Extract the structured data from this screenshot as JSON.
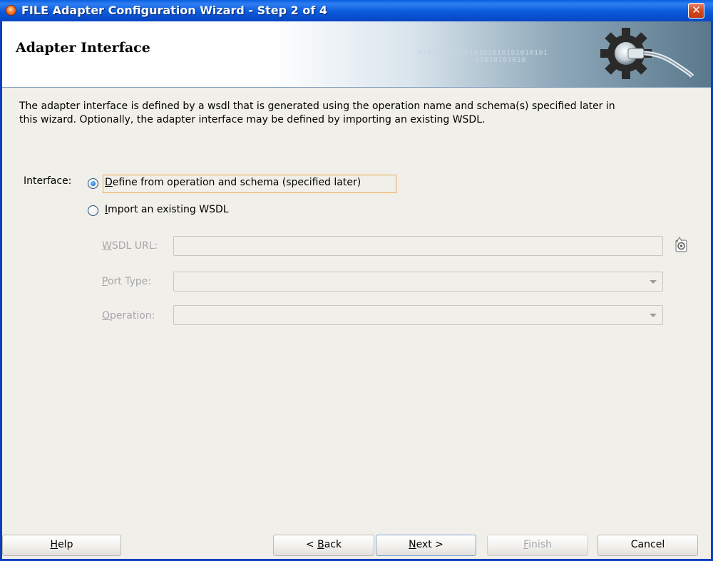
{
  "window": {
    "title": "FILE Adapter Configuration Wizard - Step 2 of 4",
    "close_label": "✕"
  },
  "banner": {
    "title": "Adapter Interface",
    "binary_line1": "0101010101010101010101010101",
    "binary_line2": "01010101010"
  },
  "description": {
    "line1": "The adapter interface is defined by a wsdl that is generated using the operation name and schema(s) specified later in",
    "line2": "this wizard.  Optionally, the adapter interface may be defined by importing an existing WSDL."
  },
  "interface": {
    "label": "Interface:",
    "option_define": {
      "mnemonic": "D",
      "rest": "efine from operation and schema (specified later)",
      "selected": true
    },
    "option_import": {
      "mnemonic": "I",
      "rest": "mport an existing WSDL",
      "selected": false
    }
  },
  "wsdl_url": {
    "mnemonic": "W",
    "rest": "SDL URL:",
    "value": "",
    "enabled": false,
    "browse_icon": "browse-wsdl-icon"
  },
  "port_type": {
    "mnemonic": "P",
    "rest": "ort Type:",
    "value": "",
    "enabled": false
  },
  "operation": {
    "mnemonic": "O",
    "rest": "peration:",
    "value": "",
    "enabled": false
  },
  "buttons": {
    "help": {
      "mnemonic": "H",
      "rest": "elp"
    },
    "back": {
      "prefix": "< ",
      "mnemonic": "B",
      "rest": "ack"
    },
    "next": {
      "mnemonic": "N",
      "rest": "ext >"
    },
    "finish": {
      "mnemonic": "F",
      "rest": "inish",
      "enabled": false
    },
    "cancel": {
      "label": "Cancel"
    }
  },
  "colors": {
    "titlebar": "#0a5bdb",
    "dialog_bg": "#f0efe9",
    "focus_outline": "#f0a84a",
    "disabled_text": "#a7a6aa"
  }
}
